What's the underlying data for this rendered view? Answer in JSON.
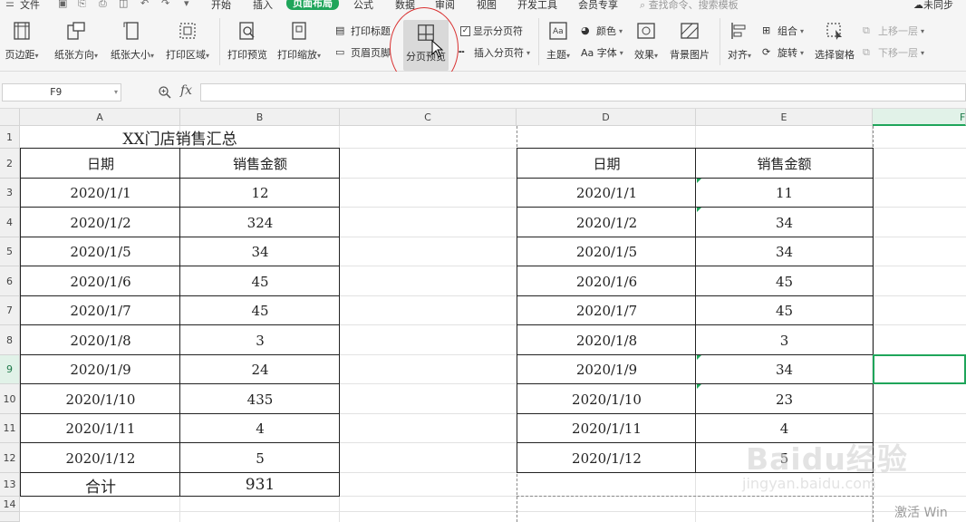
{
  "menubar": {
    "file": "文件",
    "tabs": [
      "开始",
      "插入",
      "页面布局",
      "公式",
      "数据",
      "审阅",
      "视图",
      "开发工具",
      "会员专享"
    ],
    "active_tab": "页面布局",
    "search_placeholder": "查找命令、搜索模板",
    "cloud_status": "未同步"
  },
  "ribbon": {
    "margins": "页边距",
    "orientation": "纸张方向",
    "size": "纸张大小",
    "print_area": "打印区域",
    "print_preview": "打印预览",
    "print_scaling": "打印缩放",
    "print_titles": "打印标题",
    "header_footer": "页眉页脚",
    "page_break_preview": "分页预览",
    "show_page_breaks": "显示分页符",
    "insert_page_break": "插入分页符",
    "theme": "主题",
    "colors": "颜色",
    "fonts": "Aa 字体",
    "effects": "效果",
    "background": "背景图片",
    "align": "对齐",
    "group": "组合",
    "rotate": "旋转",
    "selection_pane": "选择窗格",
    "bring_forward": "上移一层",
    "send_backward": "下移一层"
  },
  "formula_bar": {
    "name_box": "F9",
    "fx": "fx",
    "value": ""
  },
  "grid": {
    "columns": [
      "A",
      "B",
      "C",
      "D",
      "E",
      "F"
    ],
    "selected_column": "F",
    "rows": [
      "1",
      "2",
      "3",
      "4",
      "5",
      "6",
      "7",
      "8",
      "9",
      "10",
      "11",
      "12",
      "13",
      "14"
    ],
    "selected_row": "9",
    "table1": {
      "title": "XX门店销售汇总",
      "headers": [
        "日期",
        "销售金额"
      ],
      "rows": [
        [
          "2020/1/1",
          "12"
        ],
        [
          "2020/1/2",
          "324"
        ],
        [
          "2020/1/5",
          "34"
        ],
        [
          "2020/1/6",
          "45"
        ],
        [
          "2020/1/7",
          "45"
        ],
        [
          "2020/1/8",
          "3"
        ],
        [
          "2020/1/9",
          "24"
        ],
        [
          "2020/1/10",
          "435"
        ],
        [
          "2020/1/11",
          "4"
        ],
        [
          "2020/1/12",
          "5"
        ]
      ],
      "total_label": "合计",
      "total_value": "931"
    },
    "table2": {
      "headers": [
        "日期",
        "销售金额"
      ],
      "rows": [
        [
          "2020/1/1",
          "11"
        ],
        [
          "2020/1/2",
          "34"
        ],
        [
          "2020/1/5",
          "34"
        ],
        [
          "2020/1/6",
          "45"
        ],
        [
          "2020/1/7",
          "45"
        ],
        [
          "2020/1/8",
          "3"
        ],
        [
          "2020/1/9",
          "34"
        ],
        [
          "2020/1/10",
          "23"
        ],
        [
          "2020/1/11",
          "4"
        ],
        [
          "2020/1/12",
          "5"
        ]
      ]
    }
  },
  "watermarks": {
    "brand": "Baidu经验",
    "url": "jingyan.baidu.com",
    "activate_windows": "激活 Win"
  },
  "colors": {
    "accent": "#1fa55a",
    "annotation_circle": "#d93030"
  }
}
